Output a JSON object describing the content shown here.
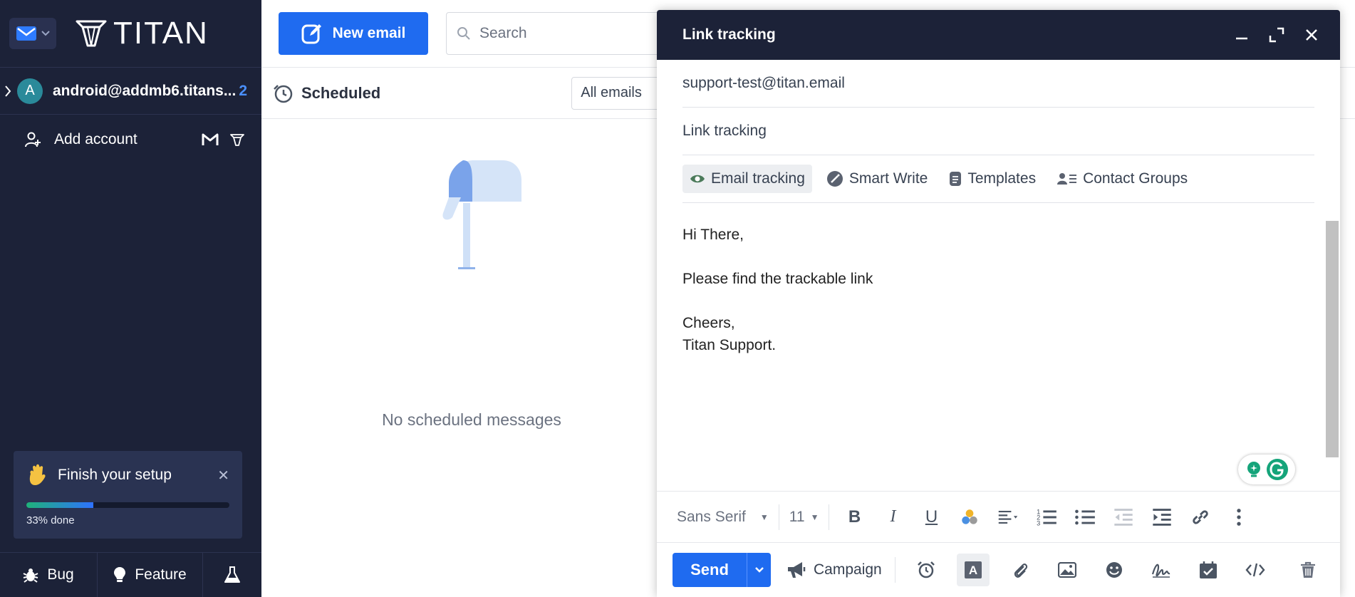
{
  "sidebar": {
    "logo_text": "TITAN",
    "account": {
      "avatar_letter": "A",
      "email": "android@addmb6.titans...",
      "count": "2"
    },
    "add_account_label": "Add account",
    "setup": {
      "title": "Finish your setup",
      "progress_fraction": 0.33,
      "percent_label": "33% done"
    },
    "bottom": {
      "bug_label": "Bug",
      "feature_label": "Feature"
    }
  },
  "toolbar": {
    "new_email_label": "New email",
    "search_placeholder": "Search"
  },
  "list": {
    "title": "Scheduled",
    "filter_value": "All emails",
    "empty_text": "No scheduled messages"
  },
  "compose": {
    "title": "Link tracking",
    "to": "support-test@titan.email",
    "subject": "Link tracking",
    "tools": {
      "email_tracking": "Email tracking",
      "smart_write": "Smart Write",
      "templates": "Templates",
      "contact_groups": "Contact Groups"
    },
    "body": {
      "line1": "Hi There,",
      "line2": "Please find the trackable link",
      "line3": "Cheers,",
      "line4": "Titan Support."
    },
    "format": {
      "font": "Sans Serif",
      "size": "11"
    },
    "send_label": "Send",
    "campaign_label": "Campaign"
  },
  "colors": {
    "accent": "#1f6bf0",
    "sidebar_bg": "#1c2238"
  }
}
